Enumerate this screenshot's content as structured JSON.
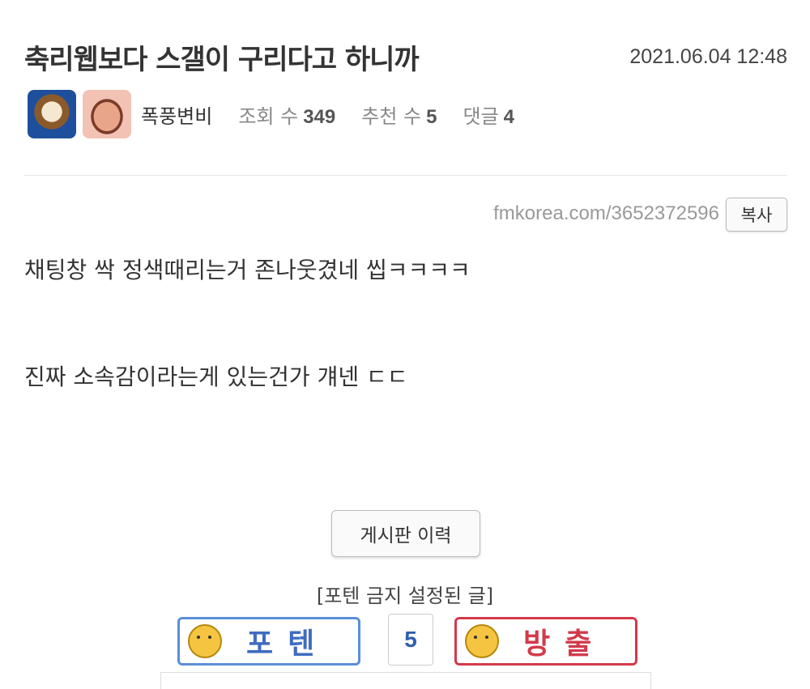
{
  "post": {
    "title": "축리웹보다 스갤이 구리다고 하니까",
    "date": "2021.06.04 12:48",
    "author": "폭풍변비",
    "views_label": "조회 수",
    "views": "349",
    "recommend_label": "추천 수",
    "recommend": "5",
    "comments_label": "댓글",
    "comments": "4",
    "url": "fmkorea.com/3652372596",
    "copy_label": "복사",
    "body": [
      "채팅창 싹 정색때리는거 존나웃겼네 씹ㅋㅋㅋㅋ",
      "진짜 소속감이라는게 있는건가 걔넨 ㄷㄷ"
    ]
  },
  "actions": {
    "history_label": "게시판 이력",
    "notice": "[포텐 금지 설정된 글]",
    "upvote_label": "포텐",
    "vote_count": "5",
    "downvote_label": "방출"
  },
  "colors": {
    "upvote": "#5a8fd6",
    "downvote": "#d23a4a"
  },
  "icons": {
    "author_avatar_1": "dog-avatar",
    "author_avatar_2": "face-avatar",
    "upvote_icon": "thumbs-up-face-icon",
    "downvote_icon": "thumbs-down-face-icon"
  }
}
